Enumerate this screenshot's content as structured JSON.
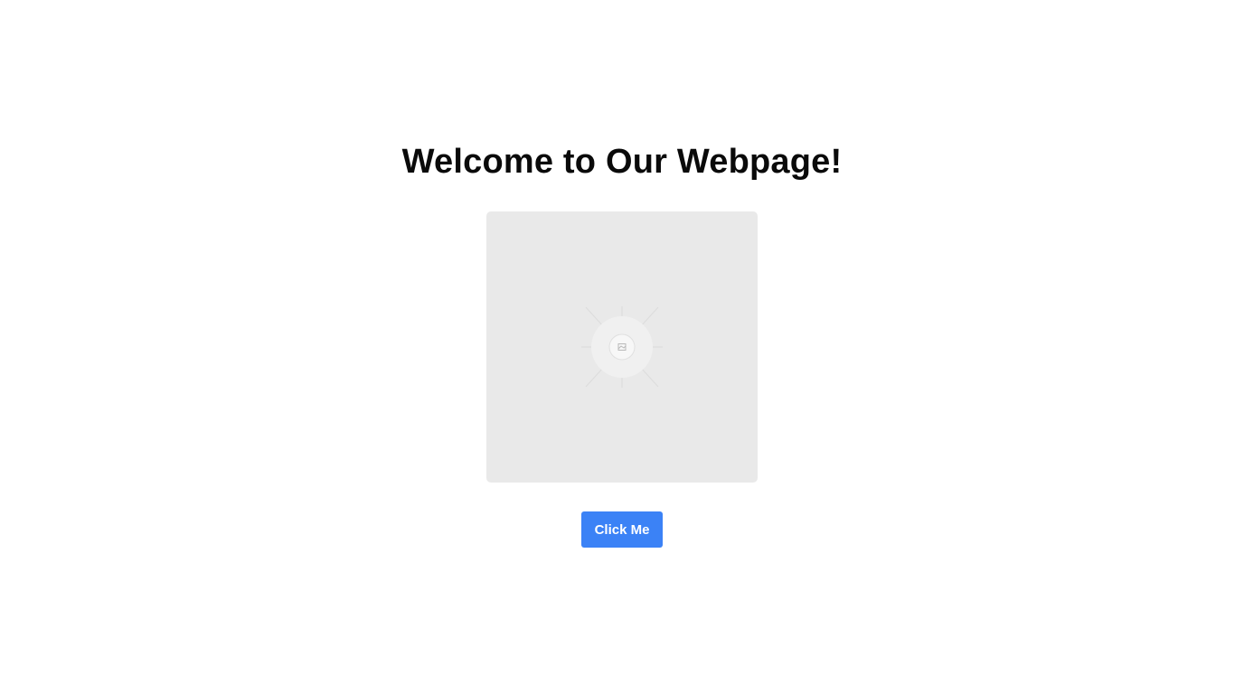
{
  "heading": {
    "text": "Welcome to Our Webpage!"
  },
  "image": {
    "icon": "image-placeholder-icon",
    "background": "#e9e9e9"
  },
  "button": {
    "label": "Click Me",
    "color": "#3b82f6"
  }
}
